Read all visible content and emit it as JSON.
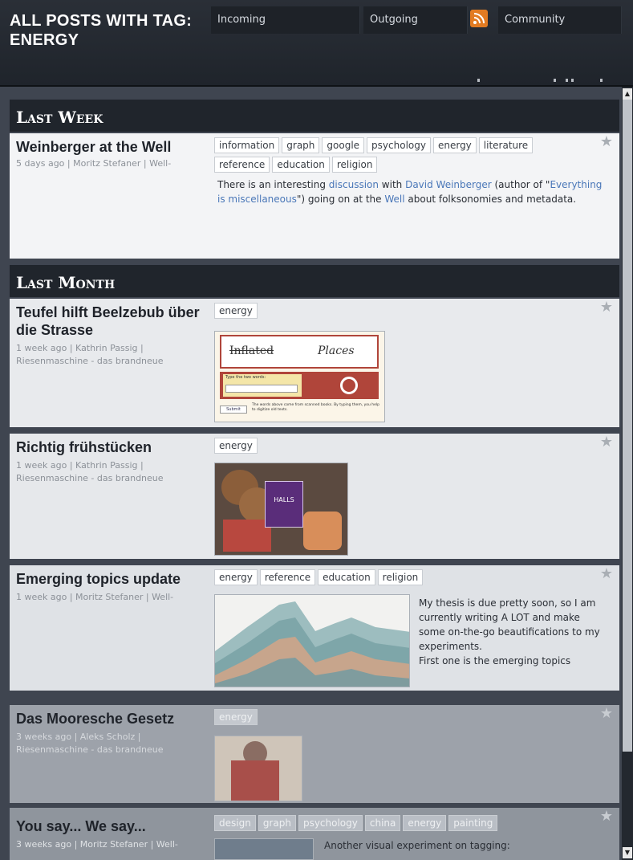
{
  "header": {
    "title": "ALL POSTS WITH TAG: ENERGY",
    "tabs": [
      "Incoming",
      "Outgoing",
      "Community"
    ],
    "rss_icon": "rss-icon"
  },
  "sections": [
    {
      "label": "Last Week",
      "posts": [
        {
          "title": "Weinberger at the Well",
          "meta": "5 days ago | Moritz Stefaner | Well-",
          "tags": [
            "information",
            "graph",
            "google",
            "psychology",
            "energy",
            "literature",
            "reference",
            "education",
            "religion"
          ],
          "text_parts": [
            "There is an interesting ",
            "discussion",
            " with ",
            "David Weinberger",
            " (author of \"",
            "Everything is miscellaneous",
            "\") going on at the ",
            "Well",
            " about folksonomies and metadata."
          ]
        }
      ]
    },
    {
      "label": "Last Month",
      "posts": [
        {
          "title": "Teufel hilft Beelzebub über die Strasse",
          "meta": "1 week ago | Kathrin Passig | Riesenmaschine - das brandneue",
          "tags": [
            "energy"
          ],
          "captcha": {
            "word1": "Inflated",
            "word2": "Places",
            "input_label": "Type the two words:",
            "submit": "Submit",
            "note": "The words above come from scanned books. By typing them, you help to digitize old texts."
          }
        },
        {
          "title": "Richtig frühstücken",
          "meta": "1 week ago | Kathrin Passig | Riesenmaschine - das brandneue",
          "tags": [
            "energy"
          ],
          "image_label": "HALLS"
        },
        {
          "title": "Emerging topics update",
          "meta": "1 week ago | Moritz Stefaner | Well-",
          "tags": [
            "energy",
            "reference",
            "education",
            "religion"
          ],
          "text": "My thesis is due pretty soon, so I am currently writing A LOT and make some on-the-go beautifications to my experiments.\nFirst one is the emerging topics"
        },
        {
          "title": "Das Mooresche Gesetz",
          "meta": "3 weeks ago | Aleks Scholz | Riesenmaschine - das brandneue",
          "tags": [
            "energy"
          ]
        },
        {
          "title": "You say... We say...",
          "meta": "3 weeks ago | Moritz Stefaner | Well-",
          "tags": [
            "design",
            "graph",
            "psychology",
            "china",
            "energy",
            "painting"
          ],
          "text": "Another visual experiment on tagging:"
        }
      ]
    }
  ],
  "colors": {
    "header_bg": "#1f242b",
    "accent_link": "#4a77b8",
    "rss": "#e27b22"
  }
}
